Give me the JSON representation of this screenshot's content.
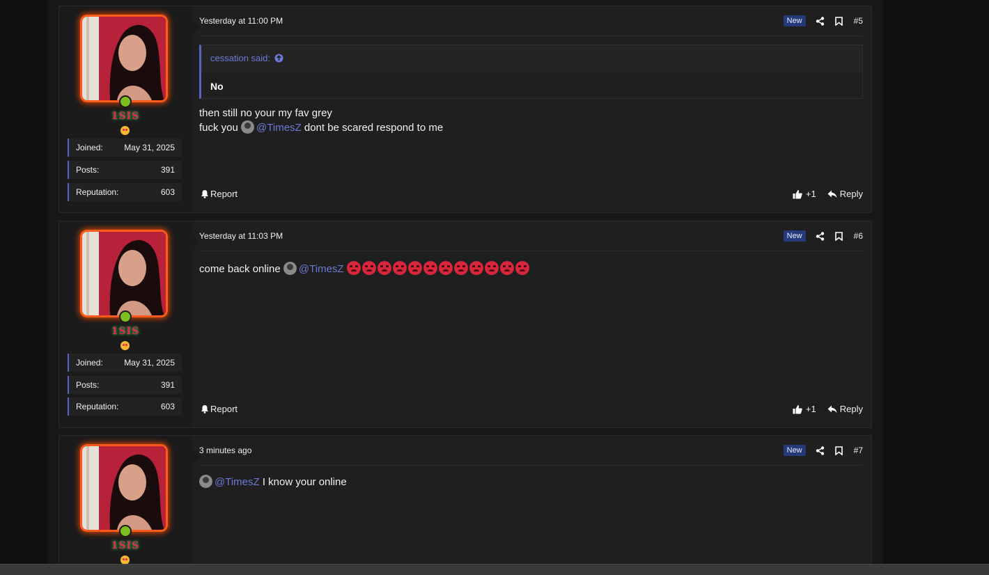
{
  "colors": {
    "accent": "#5865c7",
    "mention": "#6b7ad6",
    "new_badge": "#263a7a",
    "avatar_glow": "#ff5a1a",
    "online": "#7cbf1e",
    "username": "#e0284a"
  },
  "posts": [
    {
      "user": {
        "name": "1SIS",
        "stats": [
          {
            "label": "Joined:",
            "value": "May 31, 2025"
          },
          {
            "label": "Posts:",
            "value": "391"
          },
          {
            "label": "Reputation:",
            "value": "603"
          }
        ]
      },
      "date": "Yesterday at 11:00 PM",
      "badge": "New",
      "number": "#5",
      "quote": {
        "author": "cessation said:",
        "text": "No"
      },
      "lines": [
        "then still no your my fav grey"
      ],
      "line2_pre": "fuck you",
      "mention": "@TimesZ",
      "line2_post": " dont be scared respond to me",
      "report": "Report",
      "likes": "+1",
      "reply": "Reply"
    },
    {
      "user": {
        "name": "1SIS",
        "stats": [
          {
            "label": "Joined:",
            "value": "May 31, 2025"
          },
          {
            "label": "Posts:",
            "value": "391"
          },
          {
            "label": "Reputation:",
            "value": "603"
          }
        ]
      },
      "date": "Yesterday at 11:03 PM",
      "badge": "New",
      "number": "#6",
      "line_pre": "come back online",
      "mention": "@TimesZ",
      "emoji_name": "angry-face",
      "emoji_count": 12,
      "report": "Report",
      "likes": "+1",
      "reply": "Reply"
    },
    {
      "user": {
        "name": "1SIS"
      },
      "date": "3 minutes ago",
      "badge": "New",
      "number": "#7",
      "mention": "@TimesZ",
      "line_post": " I know your online"
    }
  ]
}
